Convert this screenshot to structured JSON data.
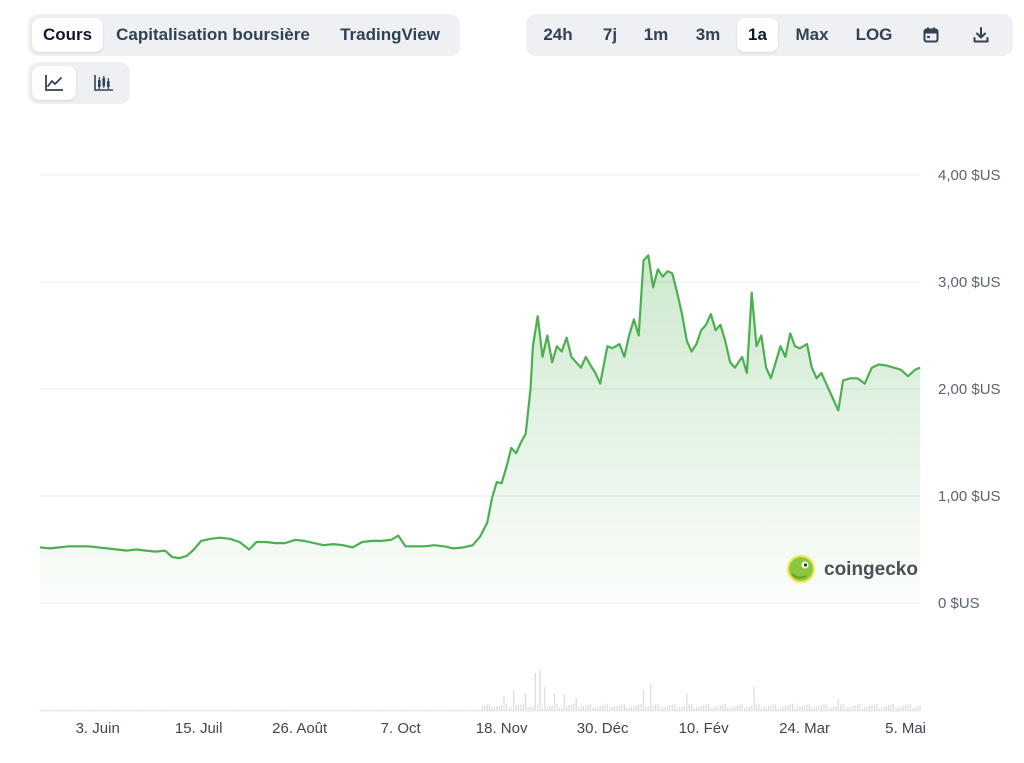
{
  "type_tabs": [
    "Cours",
    "Capitalisation boursière",
    "TradingView"
  ],
  "range_tabs": [
    "24h",
    "7j",
    "1m",
    "3m",
    "1a",
    "Max",
    "LOG"
  ],
  "icons": {
    "calendar": "calendar-icon",
    "download": "download-icon",
    "line_chart": "line-chart-icon",
    "candlestick": "candlestick-icon"
  },
  "active": {
    "type": "Cours",
    "range": "1a",
    "view": "line"
  },
  "colors": {
    "line": "#4caf50",
    "fill_top": "#4caf50",
    "grid": "#e9ecef",
    "volume": "#d8dbe0"
  },
  "watermark": "coingecko",
  "chart_data": {
    "type": "line",
    "title": "",
    "xlabel": "",
    "ylabel": "",
    "ylim": [
      0,
      4
    ],
    "yticks": [
      {
        "value": 4,
        "label": "4,00 $US"
      },
      {
        "value": 3,
        "label": "3,00 $US"
      },
      {
        "value": 2,
        "label": "2,00 $US"
      },
      {
        "value": 1,
        "label": "1,00 $US"
      },
      {
        "value": 0,
        "label": "0 $US"
      }
    ],
    "xlim": [
      "2024-05-10",
      "2025-05-11"
    ],
    "xticks": [
      {
        "date": "2024-06-03",
        "label": "3. Juin"
      },
      {
        "date": "2024-07-15",
        "label": "15. Juil"
      },
      {
        "date": "2024-08-26",
        "label": "26. Août"
      },
      {
        "date": "2024-10-07",
        "label": "7. Oct"
      },
      {
        "date": "2024-11-18",
        "label": "18. Nov"
      },
      {
        "date": "2024-12-30",
        "label": "30. Déc"
      },
      {
        "date": "2025-02-10",
        "label": "10. Fév"
      },
      {
        "date": "2025-03-24",
        "label": "24. Mar"
      },
      {
        "date": "2025-05-05",
        "label": "5. Mai"
      }
    ],
    "grid": true,
    "series": [
      {
        "points": [
          [
            "2024-05-10",
            0.52
          ],
          [
            "2024-05-14",
            0.51
          ],
          [
            "2024-05-18",
            0.52
          ],
          [
            "2024-05-22",
            0.53
          ],
          [
            "2024-05-26",
            0.53
          ],
          [
            "2024-05-30",
            0.53
          ],
          [
            "2024-06-03",
            0.52
          ],
          [
            "2024-06-07",
            0.51
          ],
          [
            "2024-06-11",
            0.5
          ],
          [
            "2024-06-15",
            0.49
          ],
          [
            "2024-06-19",
            0.5
          ],
          [
            "2024-06-23",
            0.49
          ],
          [
            "2024-06-27",
            0.48
          ],
          [
            "2024-07-01",
            0.49
          ],
          [
            "2024-07-04",
            0.43
          ],
          [
            "2024-07-07",
            0.42
          ],
          [
            "2024-07-10",
            0.44
          ],
          [
            "2024-07-13",
            0.5
          ],
          [
            "2024-07-16",
            0.58
          ],
          [
            "2024-07-20",
            0.6
          ],
          [
            "2024-07-24",
            0.61
          ],
          [
            "2024-07-28",
            0.6
          ],
          [
            "2024-08-01",
            0.57
          ],
          [
            "2024-08-05",
            0.5
          ],
          [
            "2024-08-08",
            0.57
          ],
          [
            "2024-08-12",
            0.57
          ],
          [
            "2024-08-16",
            0.56
          ],
          [
            "2024-08-20",
            0.56
          ],
          [
            "2024-08-24",
            0.59
          ],
          [
            "2024-08-28",
            0.58
          ],
          [
            "2024-09-01",
            0.56
          ],
          [
            "2024-09-05",
            0.54
          ],
          [
            "2024-09-09",
            0.55
          ],
          [
            "2024-09-13",
            0.54
          ],
          [
            "2024-09-17",
            0.52
          ],
          [
            "2024-09-21",
            0.57
          ],
          [
            "2024-09-25",
            0.58
          ],
          [
            "2024-09-29",
            0.58
          ],
          [
            "2024-10-03",
            0.59
          ],
          [
            "2024-10-06",
            0.63
          ],
          [
            "2024-10-09",
            0.53
          ],
          [
            "2024-10-13",
            0.53
          ],
          [
            "2024-10-17",
            0.53
          ],
          [
            "2024-10-21",
            0.54
          ],
          [
            "2024-10-25",
            0.53
          ],
          [
            "2024-10-29",
            0.51
          ],
          [
            "2024-11-02",
            0.52
          ],
          [
            "2024-11-06",
            0.54
          ],
          [
            "2024-11-09",
            0.62
          ],
          [
            "2024-11-12",
            0.75
          ],
          [
            "2024-11-14",
            0.98
          ],
          [
            "2024-11-16",
            1.13
          ],
          [
            "2024-11-18",
            1.12
          ],
          [
            "2024-11-20",
            1.27
          ],
          [
            "2024-11-22",
            1.45
          ],
          [
            "2024-11-24",
            1.4
          ],
          [
            "2024-11-26",
            1.5
          ],
          [
            "2024-11-28",
            1.58
          ],
          [
            "2024-11-30",
            2.0
          ],
          [
            "2024-12-01",
            2.4
          ],
          [
            "2024-12-03",
            2.68
          ],
          [
            "2024-12-05",
            2.3
          ],
          [
            "2024-12-07",
            2.5
          ],
          [
            "2024-12-09",
            2.25
          ],
          [
            "2024-12-11",
            2.4
          ],
          [
            "2024-12-13",
            2.35
          ],
          [
            "2024-12-15",
            2.48
          ],
          [
            "2024-12-17",
            2.3
          ],
          [
            "2024-12-19",
            2.25
          ],
          [
            "2024-12-21",
            2.2
          ],
          [
            "2024-12-23",
            2.3
          ],
          [
            "2024-12-25",
            2.22
          ],
          [
            "2024-12-27",
            2.15
          ],
          [
            "2024-12-29",
            2.05
          ],
          [
            "2025-01-01",
            2.4
          ],
          [
            "2025-01-03",
            2.38
          ],
          [
            "2025-01-06",
            2.42
          ],
          [
            "2025-01-08",
            2.3
          ],
          [
            "2025-01-10",
            2.5
          ],
          [
            "2025-01-12",
            2.65
          ],
          [
            "2025-01-14",
            2.5
          ],
          [
            "2025-01-16",
            3.2
          ],
          [
            "2025-01-18",
            3.25
          ],
          [
            "2025-01-20",
            2.95
          ],
          [
            "2025-01-22",
            3.12
          ],
          [
            "2025-01-24",
            3.05
          ],
          [
            "2025-01-26",
            3.1
          ],
          [
            "2025-01-28",
            3.08
          ],
          [
            "2025-01-30",
            2.9
          ],
          [
            "2025-02-01",
            2.7
          ],
          [
            "2025-02-03",
            2.45
          ],
          [
            "2025-02-05",
            2.35
          ],
          [
            "2025-02-07",
            2.42
          ],
          [
            "2025-02-09",
            2.55
          ],
          [
            "2025-02-11",
            2.6
          ],
          [
            "2025-02-13",
            2.7
          ],
          [
            "2025-02-15",
            2.55
          ],
          [
            "2025-02-17",
            2.6
          ],
          [
            "2025-02-19",
            2.45
          ],
          [
            "2025-02-21",
            2.25
          ],
          [
            "2025-02-23",
            2.2
          ],
          [
            "2025-02-26",
            2.3
          ],
          [
            "2025-02-28",
            2.15
          ],
          [
            "2025-03-02",
            2.9
          ],
          [
            "2025-03-04",
            2.4
          ],
          [
            "2025-03-06",
            2.5
          ],
          [
            "2025-03-08",
            2.2
          ],
          [
            "2025-03-10",
            2.1
          ],
          [
            "2025-03-12",
            2.25
          ],
          [
            "2025-03-14",
            2.4
          ],
          [
            "2025-03-16",
            2.3
          ],
          [
            "2025-03-18",
            2.52
          ],
          [
            "2025-03-20",
            2.4
          ],
          [
            "2025-03-22",
            2.38
          ],
          [
            "2025-03-25",
            2.42
          ],
          [
            "2025-03-27",
            2.2
          ],
          [
            "2025-03-29",
            2.1
          ],
          [
            "2025-03-31",
            2.15
          ],
          [
            "2025-04-03",
            2.0
          ],
          [
            "2025-04-07",
            1.8
          ],
          [
            "2025-04-09",
            2.08
          ],
          [
            "2025-04-12",
            2.1
          ],
          [
            "2025-04-15",
            2.1
          ],
          [
            "2025-04-18",
            2.05
          ],
          [
            "2025-04-21",
            2.2
          ],
          [
            "2025-04-24",
            2.23
          ],
          [
            "2025-04-27",
            2.22
          ],
          [
            "2025-04-30",
            2.2
          ],
          [
            "2025-05-03",
            2.18
          ],
          [
            "2025-05-06",
            2.12
          ],
          [
            "2025-05-09",
            2.18
          ],
          [
            "2025-05-11",
            2.2
          ]
        ]
      }
    ],
    "volume_spikes": [
      [
        "2024-11-19",
        0.25
      ],
      [
        "2024-11-23",
        0.35
      ],
      [
        "2024-11-28",
        0.3
      ],
      [
        "2024-12-02",
        0.55
      ],
      [
        "2024-12-04",
        0.6
      ],
      [
        "2024-12-06",
        0.4
      ],
      [
        "2024-12-10",
        0.3
      ],
      [
        "2024-12-14",
        0.28
      ],
      [
        "2024-12-19",
        0.22
      ],
      [
        "2025-01-16",
        0.35
      ],
      [
        "2025-01-19",
        0.45
      ],
      [
        "2025-02-03",
        0.3
      ],
      [
        "2025-03-03",
        0.4
      ],
      [
        "2025-04-07",
        0.2
      ]
    ]
  }
}
